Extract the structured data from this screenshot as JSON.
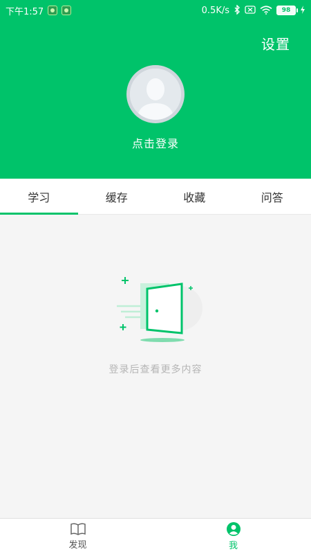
{
  "status_bar": {
    "time": "下午1:57",
    "network_speed": "0.5K/s",
    "battery": "98",
    "icons": [
      "app-badge-icon",
      "app-badge-icon",
      "bluetooth-icon",
      "sim-off-icon",
      "wifi-icon",
      "battery-icon",
      "charging-icon"
    ]
  },
  "header": {
    "settings_label": "设置",
    "login_label": "点击登录",
    "background": "#00c36a"
  },
  "tabs": [
    {
      "label": "学习",
      "active": true
    },
    {
      "label": "缓存",
      "active": false
    },
    {
      "label": "收藏",
      "active": false
    },
    {
      "label": "问答",
      "active": false
    }
  ],
  "content": {
    "empty_message": "登录后查看更多内容",
    "illustration": "door-login-icon"
  },
  "bottom_nav": [
    {
      "label": "发现",
      "icon": "book-icon",
      "active": false
    },
    {
      "label": "我",
      "icon": "user-icon",
      "active": true
    }
  ],
  "colors": {
    "accent": "#00c36a",
    "muted_text": "#b5b5b5"
  }
}
